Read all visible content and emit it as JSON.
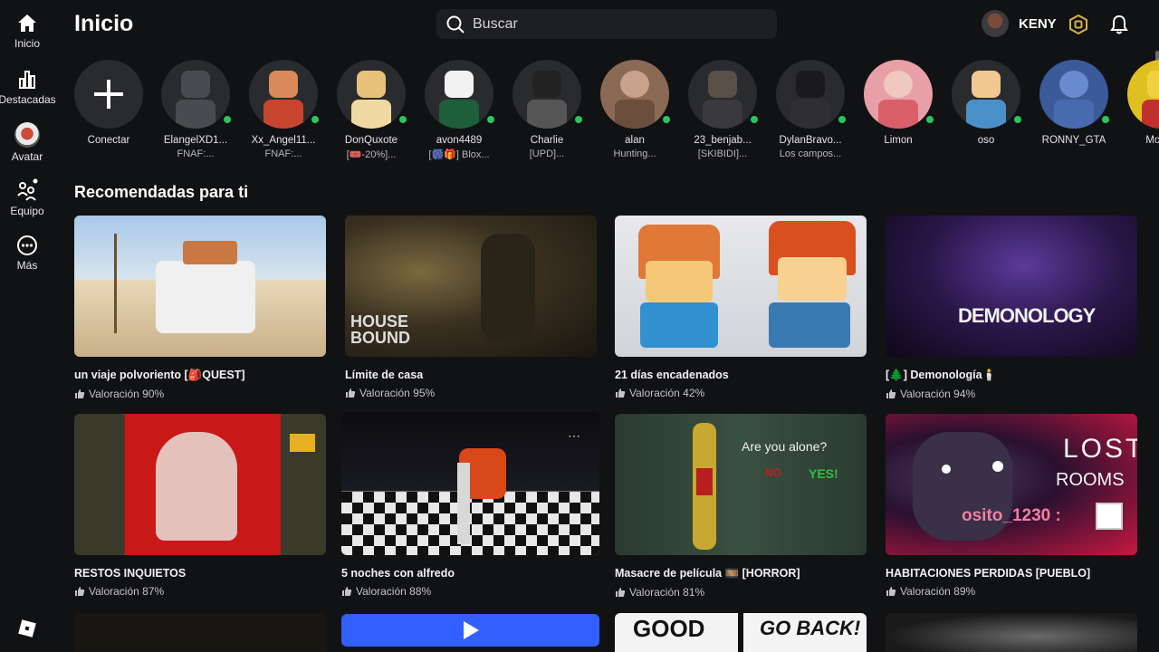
{
  "sidebar": {
    "items": [
      {
        "label": "Inicio",
        "icon": "home-icon"
      },
      {
        "label": "Destacadas",
        "icon": "charts-icon"
      },
      {
        "label": "Avatar",
        "icon": "avatar-icon"
      },
      {
        "label": "Equipo",
        "icon": "team-icon"
      },
      {
        "label": "Más",
        "icon": "more-icon"
      }
    ],
    "logo": "roblox-logo-icon"
  },
  "header": {
    "title": "Inicio",
    "search_placeholder": "Buscar",
    "username": "KENY"
  },
  "friends": [
    {
      "name": "Conectar",
      "status": ""
    },
    {
      "name": "ElangelXD1...",
      "status": "FNAF:..."
    },
    {
      "name": "Xx_Angel11...",
      "status": "FNAF:..."
    },
    {
      "name": "DonQuxote",
      "status": "[🎟️-20%]..."
    },
    {
      "name": "avon4489",
      "status": "[🎆🎁] Blox..."
    },
    {
      "name": "Charlie",
      "status": "[UPD]..."
    },
    {
      "name": "alan",
      "status": "Hunting..."
    },
    {
      "name": "23_benjab...",
      "status": "[SKIBIDI]..."
    },
    {
      "name": "DylanBravo...",
      "status": "Los campos..."
    },
    {
      "name": "Limon",
      "status": ""
    },
    {
      "name": "oso",
      "status": ""
    },
    {
      "name": "RONNY_GTA",
      "status": ""
    },
    {
      "name": "Mono_",
      "status": ""
    }
  ],
  "recommended": {
    "title": "Recomendadas para ti",
    "games": [
      {
        "name": "un viaje polvoriento [🎒QUEST]",
        "rating": "Valoración 90%"
      },
      {
        "name": "Límite de casa",
        "rating": "Valoración 95%",
        "overlay": "HOUSE BOUND"
      },
      {
        "name": "21 días encadenados",
        "rating": "Valoración 42%"
      },
      {
        "name": "[🌲] Demonología🕯️",
        "rating": "Valoración 94%",
        "overlay": "DEMONOLOGY"
      },
      {
        "name": "RESTOS INQUIETOS",
        "rating": "Valoración 87%"
      },
      {
        "name": "5 noches con alfredo",
        "rating": "Valoración 88%"
      },
      {
        "name": "Masacre de película 🎞️ [HORROR]",
        "rating": "Valoración 81%",
        "overlay1": "Are you alone?",
        "overlay2": "NO",
        "overlay3": "YES!"
      },
      {
        "name": "HABITACIONES PERDIDAS [PUEBLO]",
        "rating": "Valoración 89%",
        "overlay1": "LOST",
        "overlay2": "ROOMS",
        "overlay3": "osito_1230 :"
      }
    ],
    "row3": {
      "overlay1": "GOOD",
      "overlay2": "GO BACK!"
    }
  },
  "colors": {
    "background": "#111214",
    "online": "#2bc55e",
    "play": "#335fff"
  }
}
